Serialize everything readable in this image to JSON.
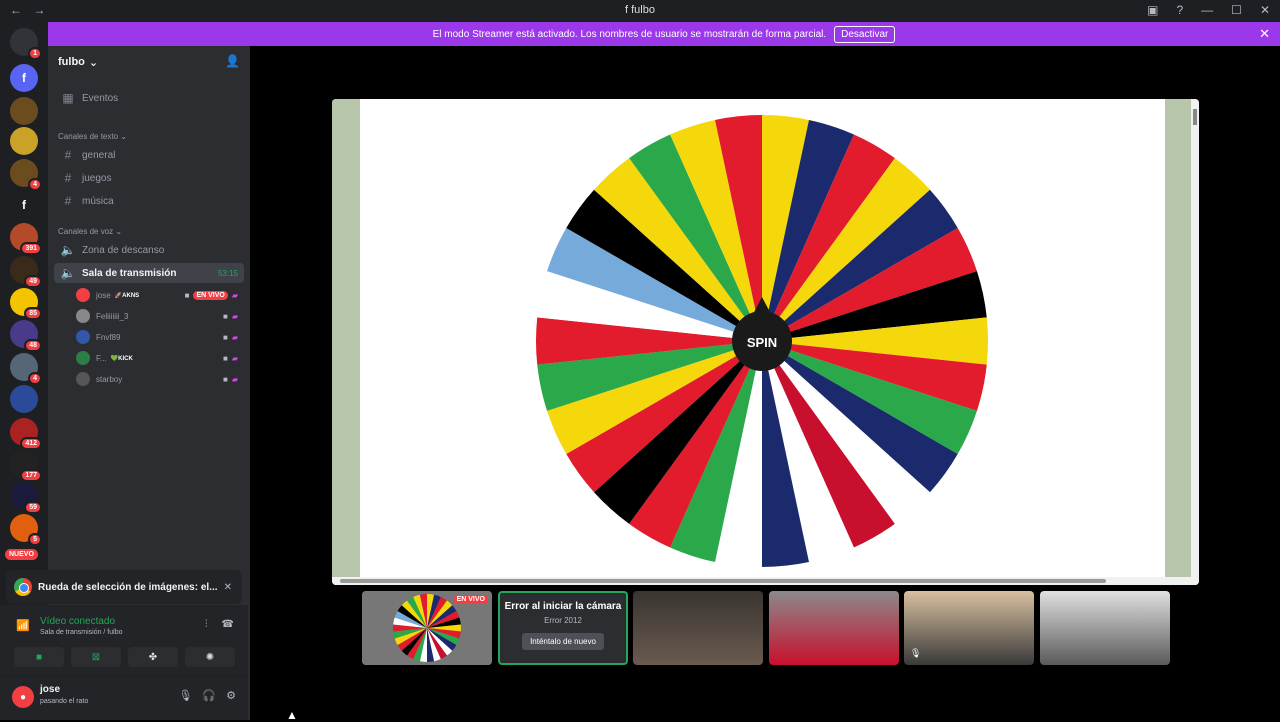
{
  "window": {
    "title": "fulbo",
    "nav_back": "←",
    "nav_forward": "→"
  },
  "banner": {
    "text": "El modo Streamer está activado. Los nombres de usuario se mostrarán de forma parcial.",
    "button": "Desactivar"
  },
  "guilds": {
    "items": [
      {
        "label": "",
        "badge": "1",
        "color": "#5865f2"
      },
      {
        "label": "f",
        "badge": "",
        "color": "#5865f2"
      },
      {
        "label": "",
        "badge": "",
        "color": "#6b4c1e"
      },
      {
        "label": "",
        "badge": "",
        "color": "#c9a227"
      },
      {
        "label": "",
        "badge": "4",
        "color": "#6b4c1e"
      },
      {
        "label": "f",
        "badge": "",
        "color": "#1e1f22"
      },
      {
        "label": "",
        "badge": "391",
        "color": "#b34a2a"
      },
      {
        "label": "",
        "badge": "49",
        "color": "#3a2a1a"
      },
      {
        "label": "",
        "badge": "85",
        "color": "#f5c400"
      },
      {
        "label": "",
        "badge": "48",
        "color": "#4a3a8a"
      },
      {
        "label": "",
        "badge": "4",
        "color": "#556677"
      },
      {
        "label": "",
        "badge": "",
        "color": "#2a4a9a"
      },
      {
        "label": "",
        "badge": "412",
        "color": "#aa2222"
      },
      {
        "label": "",
        "badge": "177",
        "color": "#222222"
      },
      {
        "label": "",
        "badge": "59",
        "color": "#1a1a3a"
      },
      {
        "label": "",
        "badge": "5",
        "color": "#e06010"
      }
    ],
    "nuevo": "NUEVO"
  },
  "server": {
    "name": "fulbo",
    "events": "Eventos",
    "text_category": "Canales de texto",
    "text_channels": [
      "general",
      "juegos",
      "música"
    ],
    "voice_category": "Canales de voz",
    "voice_channels": [
      "Zona de descanso",
      "Sala de transmisión"
    ],
    "voice_timer": "53:15",
    "voice_users": [
      {
        "name": "jose",
        "tag": "🚀AKNS",
        "live": "EN VIVO",
        "color": "#f23f43"
      },
      {
        "name": "Feliiiiiii_3",
        "tag": "",
        "live": "",
        "color": "#888888"
      },
      {
        "name": "Fnvf89",
        "tag": "",
        "live": "",
        "color": "#3355aa"
      },
      {
        "name": "F...",
        "tag": "💚KICK",
        "live": "",
        "color": "#2d7d46"
      },
      {
        "name": "starboy",
        "tag": "",
        "live": "",
        "color": "#555555"
      }
    ]
  },
  "activity": {
    "title": "Rueda de selección de imágenes: el..."
  },
  "voice_status": {
    "status": "Vídeo conectado",
    "location": "Sala de transmisión / fulbo"
  },
  "user_panel": {
    "name": "jose",
    "status": "pasando el rato"
  },
  "stage": {
    "button": "SPIN",
    "colors": {
      "left_bar": "#b7c6ab",
      "right_bar": "#b7c6ab"
    }
  },
  "wheel": {
    "segments": [
      "#f5d80c",
      "#1a2a6c",
      "#e21b2d",
      "#f5d80c",
      "#1a2a6c",
      "#e21b2d",
      "#000000",
      "#f5d80c",
      "#e21b2d",
      "#2aa84a",
      "#1a2a6c",
      "#ffffff",
      "#c8102e",
      "#ffffff",
      "#1a2a6c",
      "#ffffff",
      "#2aa84a",
      "#e21b2d",
      "#000000",
      "#e21b2d",
      "#f5d80c",
      "#2aa84a",
      "#e21b2d",
      "#ffffff",
      "#75aadb",
      "#000000",
      "#f5d80c",
      "#2aa84a",
      "#f5d80c",
      "#e21b2d"
    ]
  },
  "tiles": {
    "live": "EN VIVO",
    "error_title": "Error al iniciar la cámara",
    "error_code": "Error 2012",
    "retry": "Inténtalo de nuevo"
  }
}
